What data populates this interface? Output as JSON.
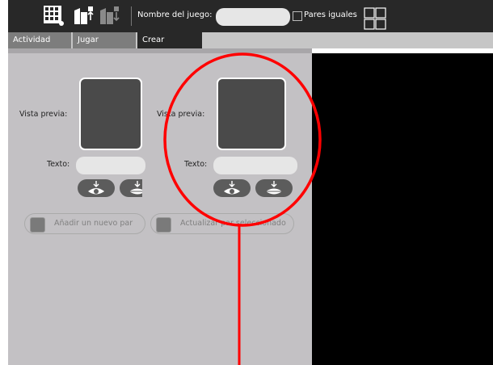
{
  "toolbar": {
    "buttons": [
      {
        "icon": "grid-icon"
      },
      {
        "icon": "upload-pair-icon"
      },
      {
        "icon": "download-pair-icon"
      }
    ],
    "name_label": "Nombre del juego:",
    "name_value": "",
    "equal_pairs_label": "Pares iguales",
    "equal_pairs_checked": false
  },
  "tabs": [
    {
      "label": "Actividad"
    },
    {
      "label": "Jugar"
    },
    {
      "label": "Crear"
    }
  ],
  "editor": {
    "cards": [
      {
        "preview_label": "Vista previa:",
        "text_label": "Texto:",
        "text_value": ""
      },
      {
        "preview_label": "Vista previa:",
        "text_label": "Texto:",
        "text_value": ""
      }
    ],
    "add_pair_label": "Añadir un nuevo par",
    "update_pair_label": "Actualizar par seleccionado"
  },
  "annotation": {
    "color": "#ff0000"
  },
  "colors": {
    "toolbar": "#282828",
    "panel": "#c3c1c4",
    "preview": "#4a4a4a"
  }
}
